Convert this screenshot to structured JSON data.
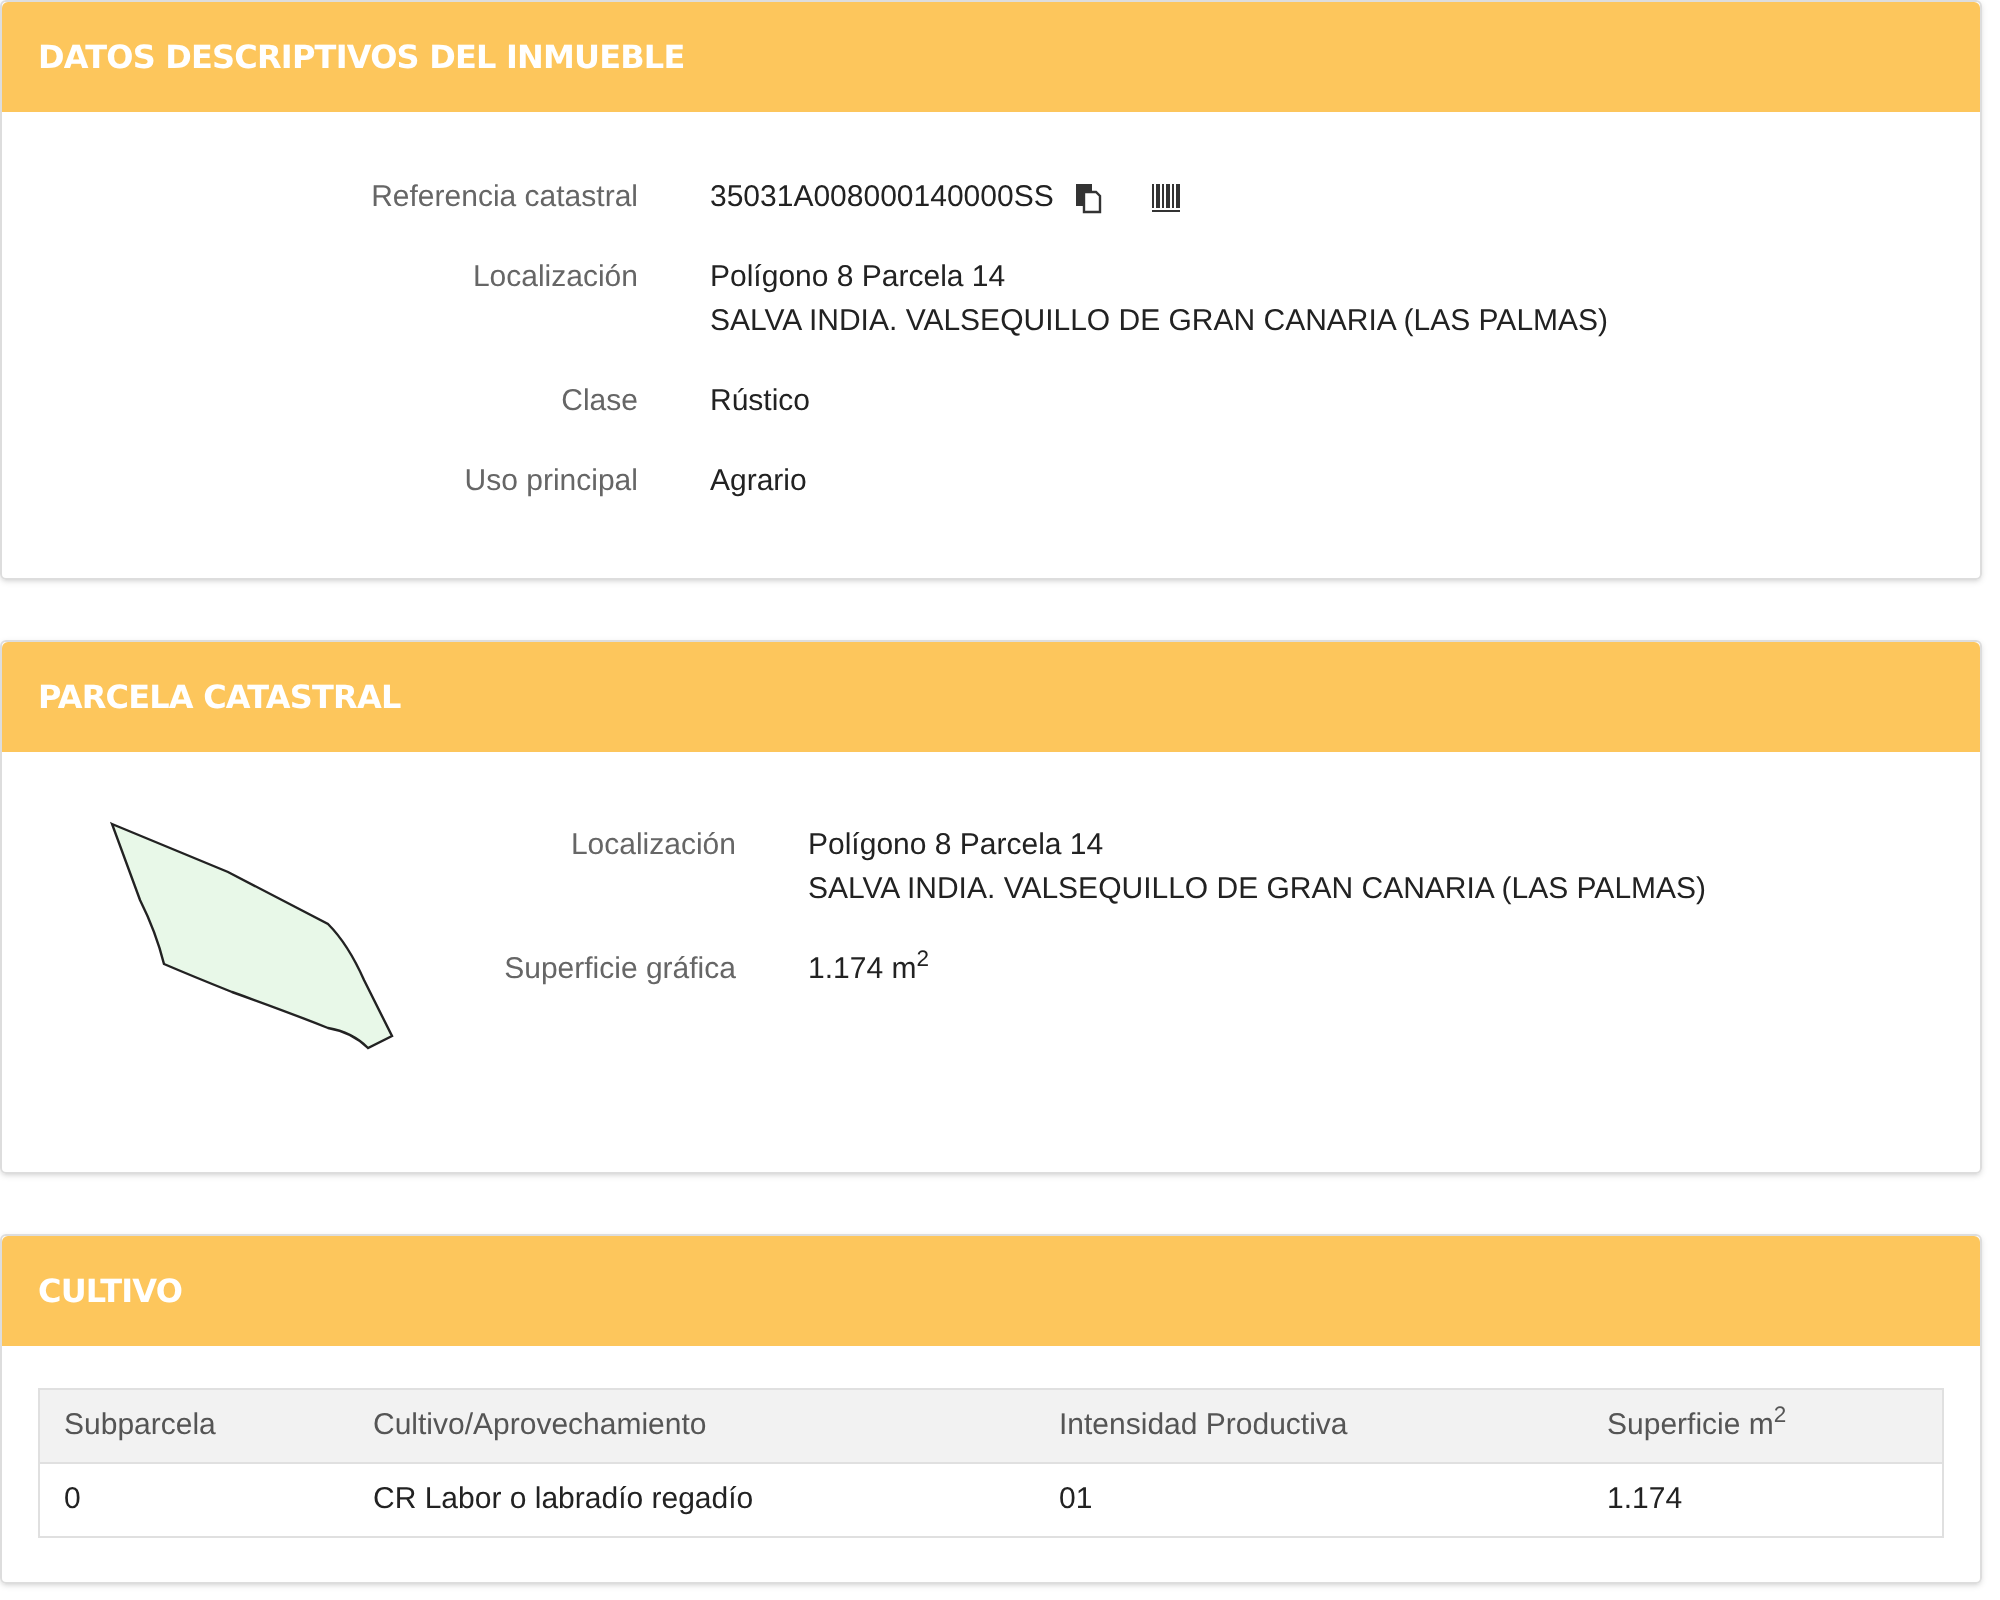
{
  "inmueble": {
    "title": "DATOS DESCRIPTIVOS DEL INMUEBLE",
    "fields": [
      {
        "label": "Referencia catastral",
        "lines": [
          "35031A008000140000SS"
        ],
        "kind": "reference"
      },
      {
        "label": "Localización",
        "lines": [
          "Polígono 8 Parcela 14",
          "SALVA INDIA. VALSEQUILLO DE GRAN CANARIA (LAS PALMAS)"
        ],
        "kind": "text"
      },
      {
        "label": "Clase",
        "lines": [
          "Rústico"
        ],
        "kind": "text"
      },
      {
        "label": "Uso principal",
        "lines": [
          "Agrario"
        ],
        "kind": "text"
      }
    ]
  },
  "parcela": {
    "title": "PARCELA CATASTRAL",
    "fields": [
      {
        "label": "Localización",
        "lines": [
          "Polígono 8 Parcela 14",
          "SALVA INDIA. VALSEQUILLO DE GRAN CANARIA (LAS PALMAS)"
        ],
        "kind": "text"
      },
      {
        "label": "Superficie gráfica",
        "lines": [
          "1.174 m$^{2}$"
        ],
        "kind": "text"
      }
    ]
  },
  "cultivo": {
    "title": "CULTIVO",
    "table": {
      "columns": [
        "Subparcela",
        "Cultivo/Aprovechamiento",
        "Intensidad Productiva",
        "Superficie m$^{2}$"
      ],
      "rows": [
        [
          "0",
          "CR Labor o labradío regadío",
          "01",
          "1.174"
        ]
      ]
    }
  }
}
